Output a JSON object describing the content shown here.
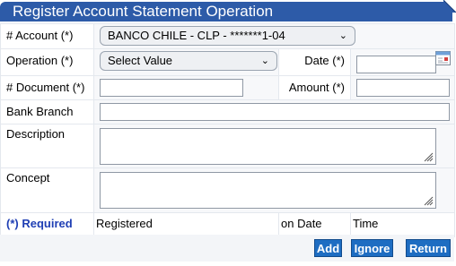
{
  "title": "Register Account Statement Operation",
  "account": {
    "label": "# Account (*)",
    "selected": "BANCO CHILE - CLP - *******1-04"
  },
  "operation": {
    "label": "Operation (*)",
    "selected": "Select Value"
  },
  "date": {
    "label": "Date (*)",
    "value": ""
  },
  "document": {
    "label": "# Document (*)",
    "value": ""
  },
  "amount": {
    "label": "Amount (*)",
    "value": ""
  },
  "branch": {
    "label": "Bank Branch",
    "value": ""
  },
  "description": {
    "label": "Description",
    "value": ""
  },
  "concept": {
    "label": "Concept",
    "value": ""
  },
  "footer": {
    "required": "(*) Required",
    "registered": "Registered",
    "on_date": "on Date",
    "time": "Time"
  },
  "buttons": {
    "add": "Add",
    "ignore": "Ignore",
    "return": "Return"
  },
  "colors": {
    "titlebar": "#2d5ba8",
    "button": "#1e6dc2",
    "required": "#1f3fb4"
  },
  "icons": {
    "calendar": "calendar-icon",
    "dropdown": "chevron-down-icon",
    "resize": "resize-grip-icon"
  }
}
